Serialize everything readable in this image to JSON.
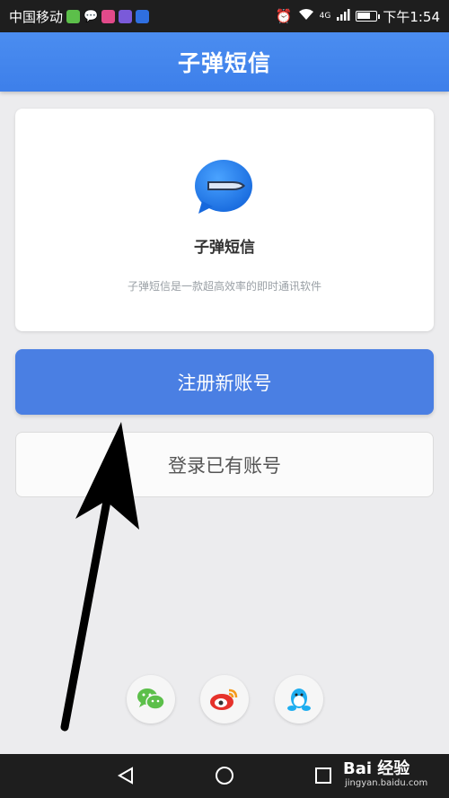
{
  "statusbar": {
    "carrier": "中国移动",
    "network": "4G",
    "time": "下午1:54",
    "battery_level": 0.75
  },
  "header": {
    "title": "子弹短信"
  },
  "card": {
    "app_name": "子弹短信",
    "description": "子弹短信是一款超高效率的即时通讯软件"
  },
  "actions": {
    "register_label": "注册新账号",
    "login_label": "登录已有账号"
  },
  "social": [
    {
      "name": "wechat-icon",
      "color": "#5cbf4a"
    },
    {
      "name": "weibo-icon",
      "color": "#e6322b"
    },
    {
      "name": "qq-icon",
      "color": "#1eaef0"
    }
  ],
  "watermark": {
    "brand": "Bai 经验",
    "url": "jingyan.baidu.com"
  },
  "colors": {
    "primary": "#4a7fe3",
    "header": "#4086ee",
    "background": "#ececee"
  }
}
